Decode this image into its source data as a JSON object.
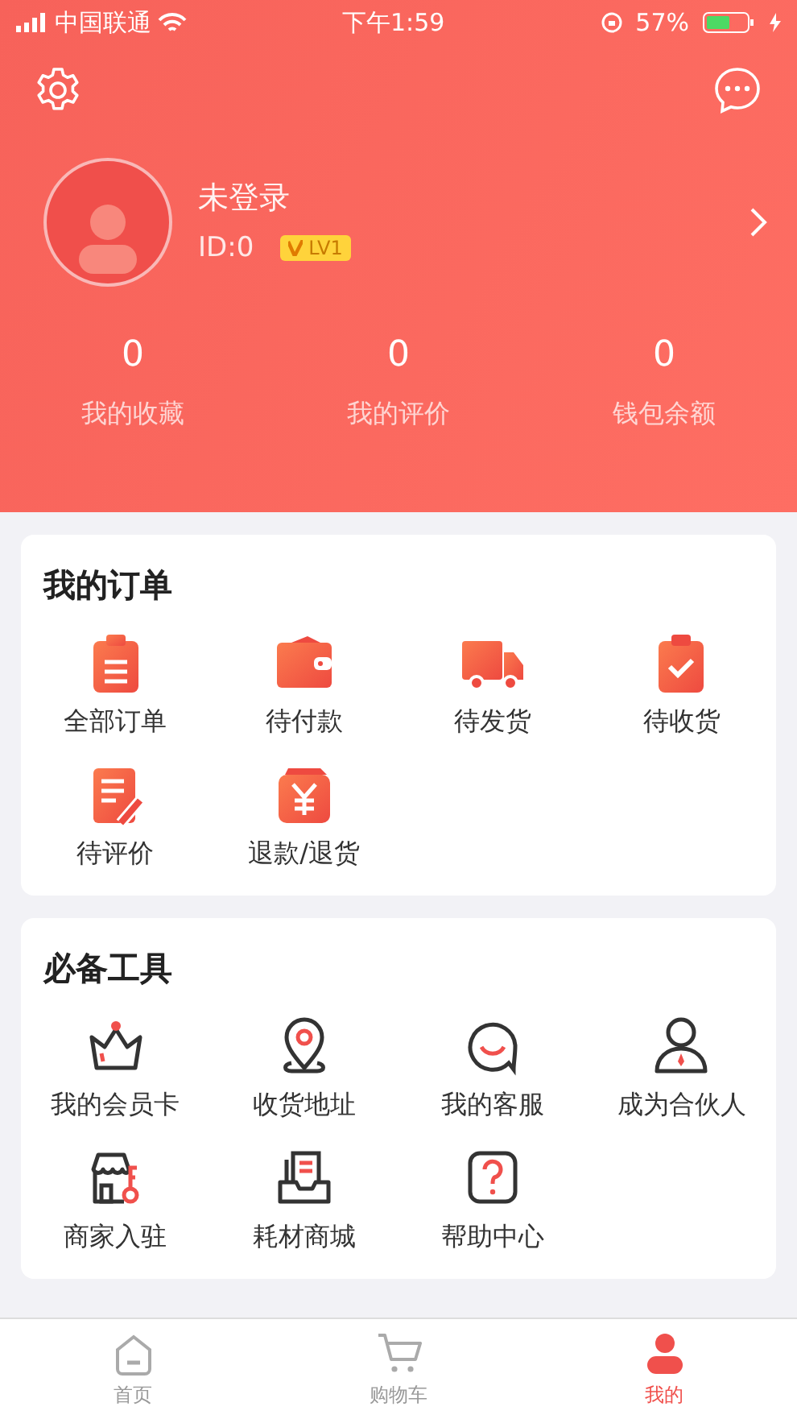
{
  "status_bar": {
    "carrier": "中国联通",
    "time": "下午1:59",
    "battery": "57%"
  },
  "profile": {
    "name": "未登录",
    "user_id": "ID:0",
    "level_badge": "LV1"
  },
  "stats": [
    {
      "value": "0",
      "label": "我的收藏"
    },
    {
      "value": "0",
      "label": "我的评价"
    },
    {
      "value": "0",
      "label": "钱包余额"
    }
  ],
  "orders": {
    "title": "我的订单",
    "items": [
      "全部订单",
      "待付款",
      "待发货",
      "待收货",
      "待评价",
      "退款/退货"
    ]
  },
  "tools": {
    "title": "必备工具",
    "items": [
      "我的会员卡",
      "收货地址",
      "我的客服",
      "成为合伙人",
      "商家入驻",
      "耗材商城",
      "帮助中心"
    ]
  },
  "tab_bar": [
    {
      "label": "首页",
      "selected": false
    },
    {
      "label": "购物车",
      "selected": false
    },
    {
      "label": "我的",
      "selected": true
    }
  ]
}
